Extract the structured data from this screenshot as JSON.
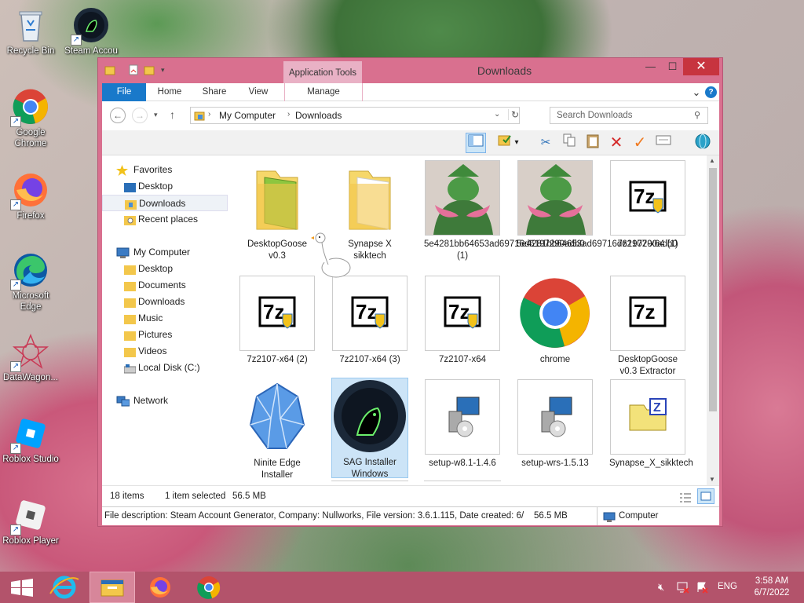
{
  "desktop": {
    "icons": [
      {
        "label": "Recycle Bin"
      },
      {
        "label": "Steam Accou"
      },
      {
        "label": "Google Chrome"
      },
      {
        "label": "Firefox"
      },
      {
        "label": "Microsoft Edge"
      },
      {
        "label": "DataWagon..."
      },
      {
        "label": "Roblox Studio"
      },
      {
        "label": "Roblox Player"
      }
    ],
    "goose_icon": "goose-icon"
  },
  "window": {
    "title": "Downloads",
    "context_tab": "Application Tools",
    "buttons": {
      "minimize": "—",
      "maximize": "☐",
      "close": "✕"
    },
    "ribbon": {
      "tabs": [
        "File",
        "Home",
        "Share",
        "View",
        "Manage"
      ],
      "help": "?",
      "expand": "⌄"
    },
    "address": {
      "crumbs": [
        "My Computer",
        "Downloads"
      ],
      "separator": "›"
    },
    "search": {
      "placeholder": "Search Downloads"
    },
    "nav": {
      "favorites_header": "Favorites",
      "favorites": [
        "Desktop",
        "Downloads",
        "Recent places"
      ],
      "computer_header": "My Computer",
      "computer": [
        "Desktop",
        "Documents",
        "Downloads",
        "Music",
        "Pictures",
        "Videos",
        "Local Disk (C:)"
      ],
      "network": "Network"
    },
    "files": [
      {
        "name": "DesktopGoose v0.3",
        "icon": "folder-icon"
      },
      {
        "name": "Synapse X sikktech",
        "icon": "folder-icon"
      },
      {
        "name": "5e4281bb64653ad69716d6197290adb0 (1)",
        "icon": "image-thumbnail-icon"
      },
      {
        "name": "5e4281bb64653ad69716d6197290adb0",
        "icon": "image-thumbnail-icon"
      },
      {
        "name": "7z2107-x64 (1)",
        "icon": "7zip-installer-icon"
      },
      {
        "name": "7z2107-x64 (2)",
        "icon": "7zip-installer-icon"
      },
      {
        "name": "7z2107-x64 (3)",
        "icon": "7zip-installer-icon"
      },
      {
        "name": "7z2107-x64",
        "icon": "7zip-installer-icon"
      },
      {
        "name": "chrome",
        "icon": "chrome-icon"
      },
      {
        "name": "DesktopGoose v0.3 Extractor",
        "icon": "7zip-icon"
      },
      {
        "name": "Ninite Edge Installer",
        "icon": "ninite-icon"
      },
      {
        "name": "SAG Installer Windows",
        "icon": "steam-icon"
      },
      {
        "name": "setup-w8.1-1.4.6",
        "icon": "setup-icon"
      },
      {
        "name": "setup-wrs-1.5.13",
        "icon": "setup-icon"
      },
      {
        "name": "Synapse_X_sikktech",
        "icon": "zip-icon"
      }
    ],
    "status": {
      "count": "18 items",
      "selected": "1 item selected",
      "size": "56.5 MB"
    },
    "description": {
      "text": "File description: Steam Account Generator, Company: Nullworks, File version: 3.6.1.115, Date created: 6/",
      "size": "56.5 MB",
      "location": "Computer"
    }
  },
  "taskbar": {
    "apps": [
      "start-button",
      "internet-explorer-icon",
      "file-explorer-icon",
      "firefox-icon",
      "chrome-icon"
    ],
    "tray": {
      "lang": "ENG",
      "time": "3:58 AM",
      "date": "6/7/2022"
    }
  },
  "colors": {
    "accent": "#1979ca",
    "window_frame": "#d9708f",
    "taskbar": "#b3536b",
    "close": "#c7343f",
    "selection": "#cce4f7"
  }
}
